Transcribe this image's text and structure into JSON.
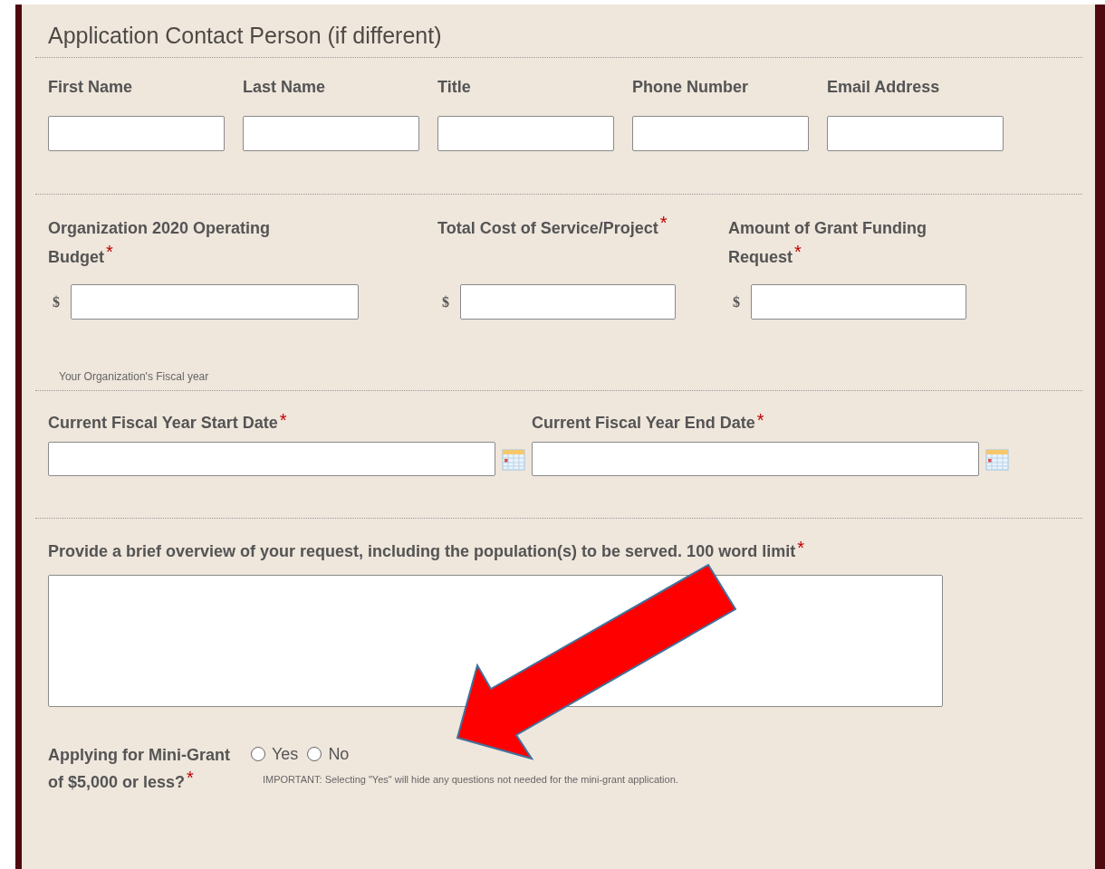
{
  "heading": "Application Contact Person (if different)",
  "contact_fields": [
    {
      "label": "First Name"
    },
    {
      "label": "Last Name"
    },
    {
      "label": "Title"
    },
    {
      "label": "Phone Number"
    },
    {
      "label": "Email Address"
    }
  ],
  "budget_fields": [
    {
      "label": "Organization 2020 Operating Budget",
      "required_mark": "*",
      "prefix": "$"
    },
    {
      "label": "Total Cost of Service/Project",
      "required_mark": "*",
      "prefix": "$"
    },
    {
      "label": "Amount of Grant Funding Request",
      "required_mark": "*",
      "prefix": "$"
    }
  ],
  "fiscal_note": "Your Organization's Fiscal year",
  "date_fields": [
    {
      "label": "Current Fiscal Year Start Date",
      "required_mark": "*"
    },
    {
      "label": "Current Fiscal Year End Date",
      "required_mark": "*"
    }
  ],
  "overview": {
    "label": "Provide a brief overview of your request, including the population(s) to be served. 100 word limit",
    "required_mark": "*"
  },
  "mini_grant": {
    "label": "Applying for Mini-Grant of $5,000 or less?",
    "required_mark": "*",
    "options": [
      {
        "label": "Yes",
        "selected": false
      },
      {
        "label": "No",
        "selected": false
      }
    ],
    "note": "IMPORTANT: Selecting \"Yes\" will hide any questions not needed for the mini-grant application."
  }
}
